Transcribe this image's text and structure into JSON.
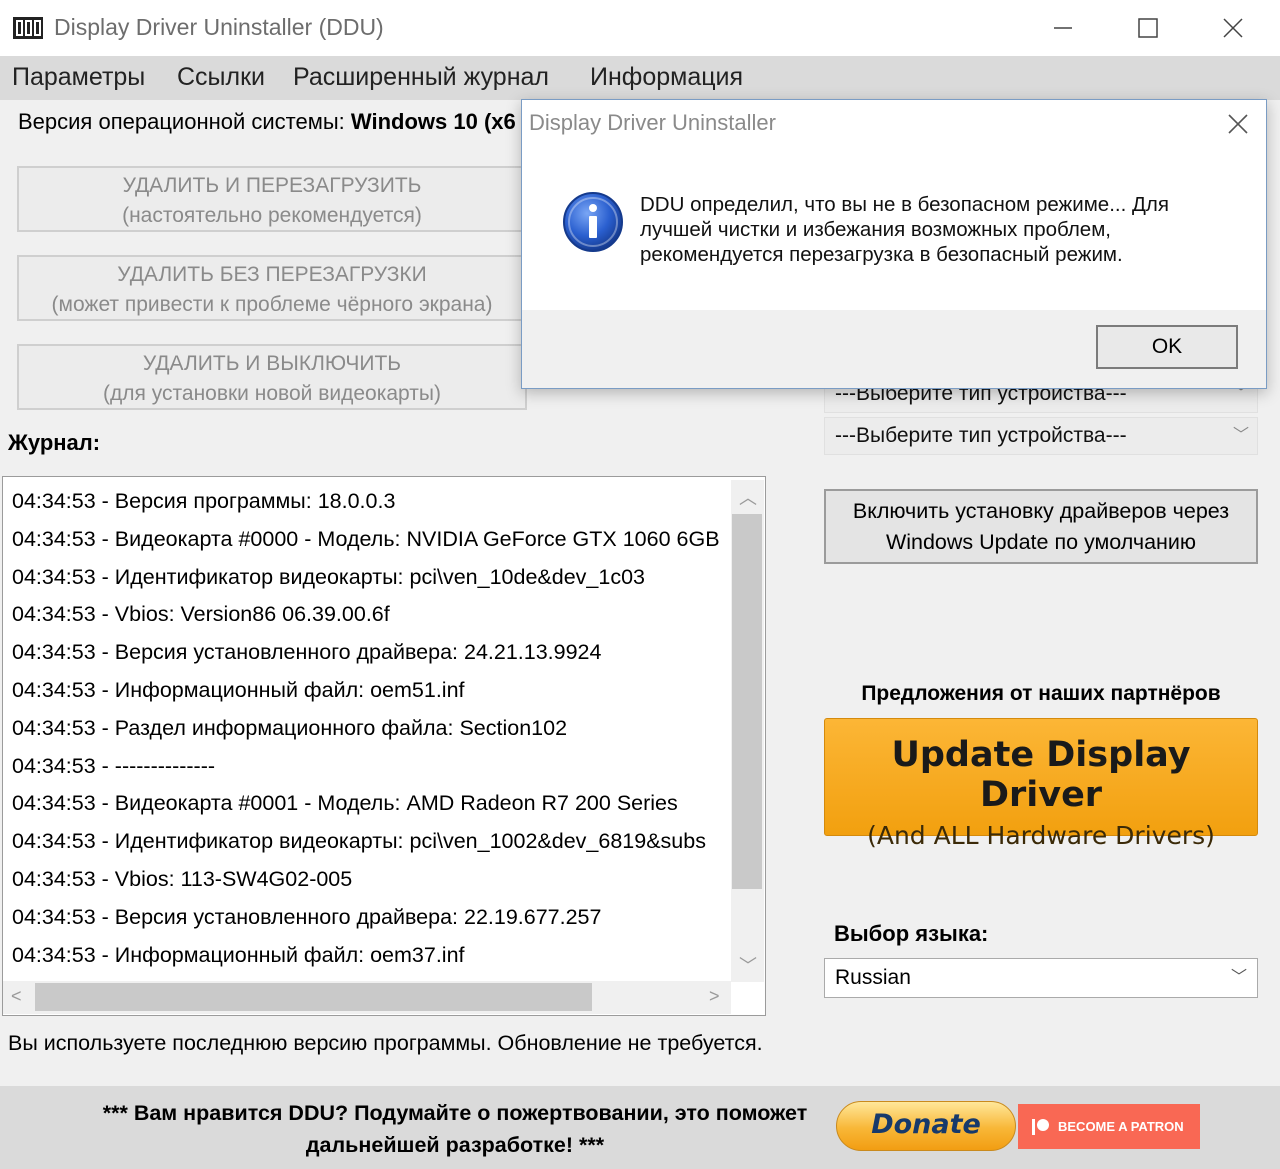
{
  "window": {
    "title": "Display Driver Uninstaller (DDU)",
    "icon": "ddu-app-icon"
  },
  "menu": {
    "items": [
      "Параметры",
      "Ссылки",
      "Расширенный журнал",
      "Информация"
    ]
  },
  "os": {
    "label": "Версия операционной системы:",
    "value": "Windows 10 (x6"
  },
  "actions": {
    "clean_restart": {
      "line1": "УДАЛИТЬ И ПЕРЕЗАГРУЗИТЬ",
      "line2": "(настоятельно рекомендуется)"
    },
    "clean_no_restart": {
      "line1": "УДАЛИТЬ БЕЗ ПЕРЕЗАГРУЗКИ",
      "line2": "(может привести к проблеме чёрного экрана)"
    },
    "clean_shutdown": {
      "line1": "УДАЛИТЬ И ВЫКЛЮЧИТЬ",
      "line2": "(для установки новой видеокарты)"
    }
  },
  "journal": {
    "title": "Журнал:",
    "lines": [
      "04:34:53 - Версия программы: 18.0.0.3",
      "04:34:53 - Видеокарта #0000 - Модель: NVIDIA GeForce GTX 1060 6GB",
      "04:34:53 - Идентификатор видеокарты: pci\\ven_10de&dev_1c03",
      "04:34:53 - Vbios: Version86 06.39.00.6f",
      "04:34:53 - Версия установленного драйвера: 24.21.13.9924",
      "04:34:53 - Информационный файл: oem51.inf",
      "04:34:53 - Раздел информационного файла: Section102",
      "04:34:53 - --------------",
      "04:34:53 - Видеокарта #0001 - Модель: AMD Radeon R7 200 Series",
      "04:34:53 - Идентификатор видеокарты: pci\\ven_1002&dev_6819&subs",
      "04:34:53 - Vbios: 113-SW4G02-005",
      "04:34:53 - Версия установленного драйвера: 22.19.677.257",
      "04:34:53 - Информационный файл: oem37.inf"
    ]
  },
  "status": "Вы используете последнюю версию программы. Обновление не требуется.",
  "device_selects": {
    "first": "---Выберите тип устройства---",
    "second": "---Выберите тип устройства---"
  },
  "windows_update_button": {
    "line1": "Включить установку драйверов через",
    "line2": "Windows Update по умолчанию"
  },
  "partners": {
    "title": "Предложения от наших партнёров",
    "banner_title": "Update Display Driver",
    "banner_subtitle": "(And ALL Hardware Drivers)"
  },
  "language": {
    "label": "Выбор языка:",
    "selected": "Russian"
  },
  "footer": {
    "line1": "*** Вам нравится DDU? Подумайте о пожертвовании, это поможет",
    "line2": "дальнейшей разработке! ***",
    "donate": "Donate",
    "patron": "BECOME A PATRON"
  },
  "dialog": {
    "title": "Display Driver Uninstaller",
    "message_lines": [
      "DDU определил, что вы не в безопасном режиме... Для",
      "лучшей чистки и избежания возможных проблем,",
      "рекомендуется перезагрузка в безопасный режим."
    ],
    "ok": "OK",
    "icon": "info-icon"
  },
  "colors": {
    "banner_orange": "#f7a81f",
    "patron_red": "#f96854",
    "dialog_border": "#7a9cc4"
  }
}
